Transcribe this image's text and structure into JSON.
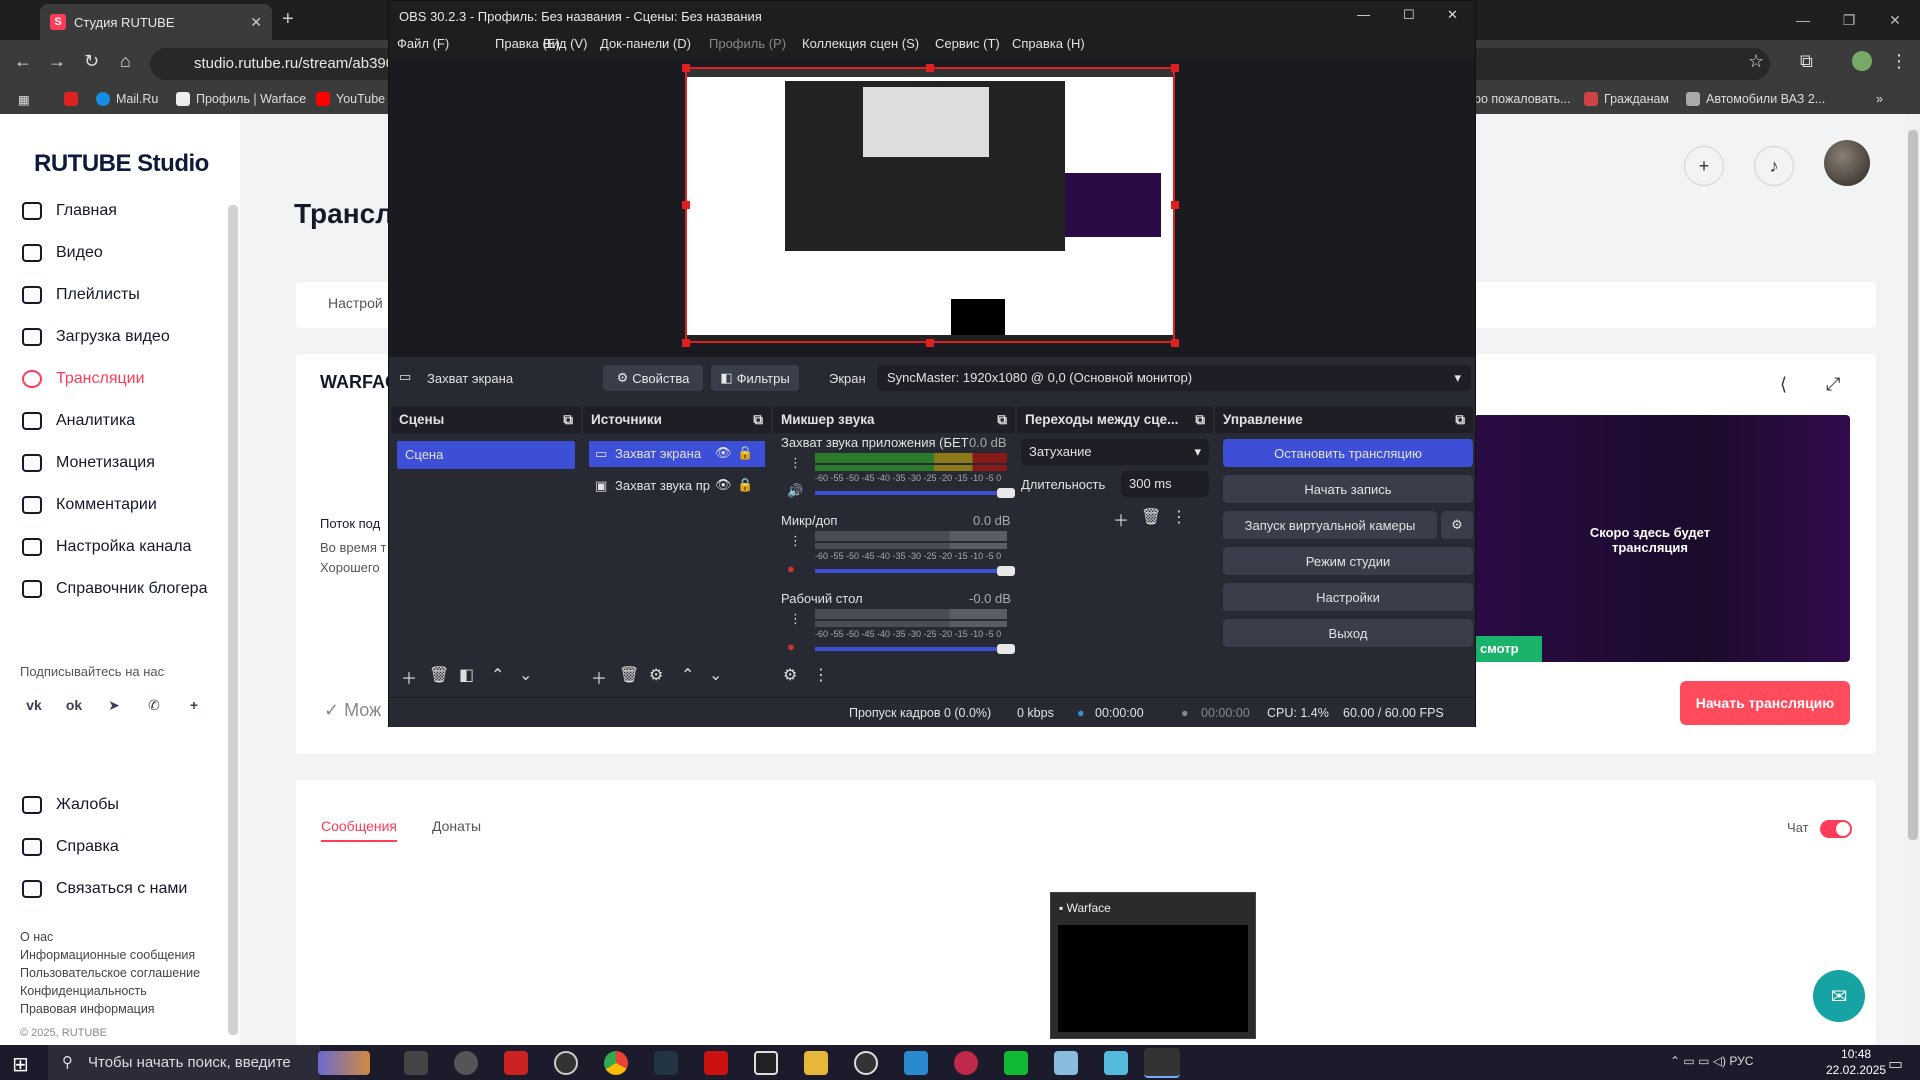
{
  "browser": {
    "tab_title": "Студия RUTUBE",
    "url": "studio.rutube.ru/stream/ab390c",
    "bookmarks": [
      "Mail.Ru",
      "Профиль | Warface",
      "YouTube",
      "ро пожаловать...",
      "Гражданам",
      "Автомобили ВАЗ 2..."
    ]
  },
  "rutube": {
    "logo": "RUTUBE Studio",
    "nav": [
      "Главная",
      "Видео",
      "Плейлисты",
      "Загрузка видео",
      "Трансляции",
      "Аналитика",
      "Монетизация",
      "Комментарии",
      "Настройка канала",
      "Справочник блогера"
    ],
    "active_index": 4,
    "subscribe_label": "Подписывайтесь на нас",
    "social": [
      "vk",
      "ok",
      "tg",
      "vb",
      "+"
    ],
    "nav_bottom": [
      "Жалобы",
      "Справка",
      "Связаться с нами"
    ],
    "footer": [
      "О нас",
      "Информационные сообщения",
      "Пользовательское соглашение",
      "Конфиденциальность",
      "Правовая информация",
      "© 2025, RUTUBE"
    ],
    "page_title_partial": "Трансл",
    "settings_tab_partial": "Настрой",
    "stream_title_partial": "WARFAC",
    "stream_key_partial": "Поток под",
    "hint1_partial": "Во время т",
    "hint2_partial": "Хорошего",
    "check_partial": "Мож",
    "preview_text": "Скоро здесь будет трансляция",
    "watch_partial": "смотр",
    "start_button": "Начать трансляцию",
    "tabs": [
      "Сообщения",
      "Донаты"
    ],
    "chat_label": "Чат",
    "chat_enabled": true
  },
  "obs": {
    "title": "OBS 30.2.3 - Профиль: Без названия - Сцены: Без названия",
    "menu": [
      "Файл (F)",
      "Правка (E)",
      "Вид (V)",
      "Док-панели (D)",
      "Профиль (P)",
      "Коллекция сцен (S)",
      "Сервис (T)",
      "Справка (H)"
    ],
    "source_bar": {
      "source": "Захват экрана",
      "properties": "Свойства",
      "filters": "Фильтры",
      "screen_label": "Экран",
      "monitor": "SyncMaster: 1920x1080 @ 0,0 (Основной монитор)"
    },
    "docks": {
      "scenes": "Сцены",
      "sources": "Источники",
      "mixer": "Микшер звука",
      "transitions": "Переходы между сце...",
      "controls": "Управление"
    },
    "scenes": [
      "Сцена"
    ],
    "sources": [
      "Захват экрана",
      "Захват звука пр"
    ],
    "mixer": [
      {
        "name": "Захват звука приложения (БЕТ",
        "db": "0.0 dB"
      },
      {
        "name": "Микр/доп",
        "db": "0.0 dB"
      },
      {
        "name": "Рабочий стол",
        "db": "-0.0 dB"
      }
    ],
    "meter_scale": "-60 -55 -50 -45 -40 -35 -30 -25 -20 -15 -10 -5 0",
    "transition": {
      "type": "Затухание",
      "duration_label": "Длительность",
      "duration": "300 ms"
    },
    "controls": [
      "Остановить трансляцию",
      "Начать запись",
      "Запуск виртуальной камеры",
      "Режим студии",
      "Настройки",
      "Выход"
    ],
    "status": {
      "dropped": "Пропуск кадров 0 (0.0%)",
      "bitrate": "0 kbps",
      "stream_time": "00:00:00",
      "rec_time": "00:00:00",
      "cpu": "CPU: 1.4%",
      "fps": "60.00 / 60.00 FPS"
    }
  },
  "taskbar": {
    "search_placeholder": "Чтобы начать поиск, введите",
    "lang": "РУС",
    "time": "10:48",
    "date": "22.02.2025",
    "thumb_title": "Warface"
  },
  "colors": {
    "rutube_accent": "#ff3c5a",
    "obs_bg": "#272a33",
    "obs_accent": "#3d4fd6"
  }
}
